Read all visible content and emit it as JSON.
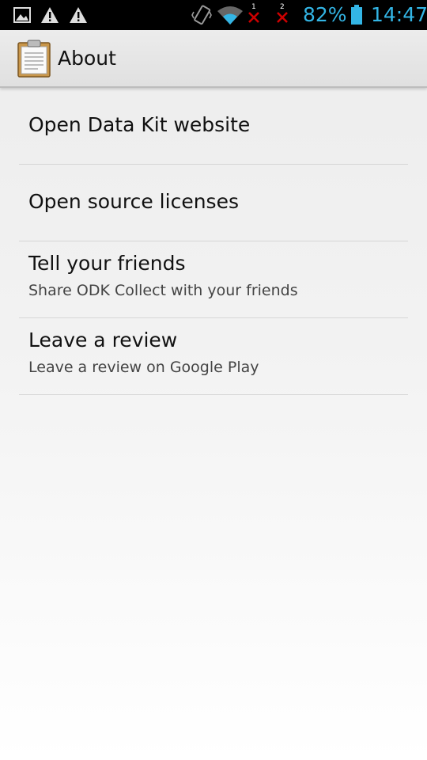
{
  "status_bar": {
    "battery": "82%",
    "time": "14:47",
    "sim1": "1",
    "sim2": "2",
    "icons": [
      "image-icon",
      "warning-icon",
      "warning-icon",
      "vibrate-icon",
      "wifi-icon",
      "no-signal-icon",
      "no-signal-icon",
      "battery-icon"
    ],
    "accent": "#33b5e5"
  },
  "action_bar": {
    "title": "About",
    "icon": "clipboard-icon"
  },
  "items": [
    {
      "title": "Open Data Kit website"
    },
    {
      "title": "Open source licenses"
    },
    {
      "title": "Tell your friends",
      "subtitle": "Share ODK Collect with your friends"
    },
    {
      "title": "Leave a review",
      "subtitle": "Leave a review on Google Play"
    }
  ]
}
